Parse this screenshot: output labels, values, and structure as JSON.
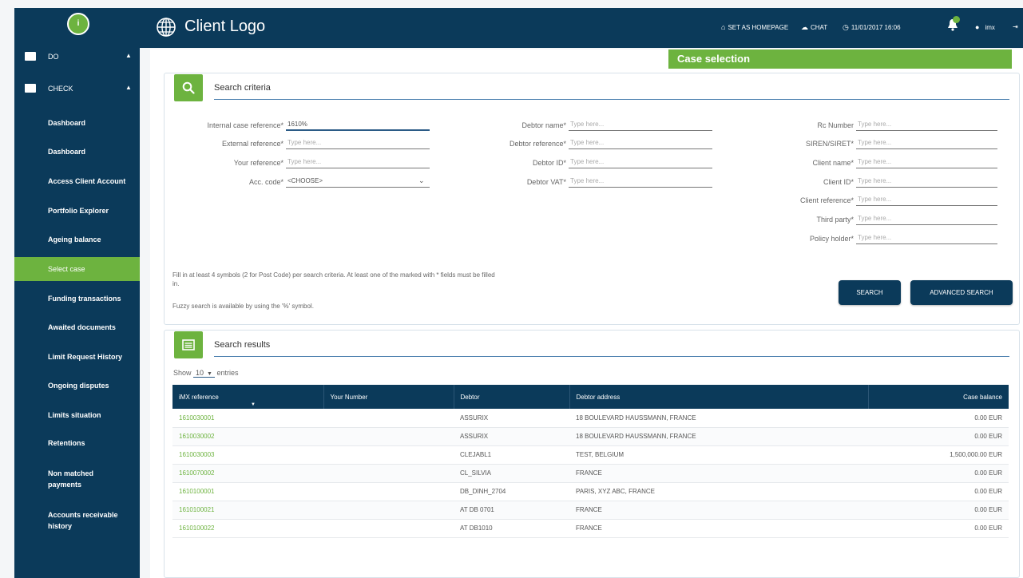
{
  "sidebar": {
    "logo_letter": "i",
    "groups": [
      {
        "label": "DO",
        "caret": "▲"
      },
      {
        "label": "CHECK",
        "caret": "▲"
      }
    ],
    "items": [
      {
        "label": "Dashboard"
      },
      {
        "label": "Dashboard"
      },
      {
        "label": "Access Client Account"
      },
      {
        "label": "Portfolio Explorer"
      },
      {
        "label": "Ageing balance"
      },
      {
        "label": "Select case"
      },
      {
        "label": "Funding transactions"
      },
      {
        "label": "Awaited documents"
      },
      {
        "label": "Limit Request History"
      },
      {
        "label": "Ongoing disputes"
      },
      {
        "label": "Limits situation"
      },
      {
        "label": "Retentions"
      },
      {
        "label": "Non matched",
        "label2": "payments"
      },
      {
        "label": "Accounts receivable",
        "label2": "history"
      }
    ]
  },
  "header": {
    "brand": "Client Logo",
    "set_homepage": "SET AS HOMEPAGE",
    "chat": "CHAT",
    "datetime": "11/01/2017 16:06",
    "user": "imx"
  },
  "case_tab": "Case selection",
  "search_criteria": {
    "title": "Search criteria",
    "fields": {
      "internal_case_reference": {
        "label": "Internal case reference*",
        "value": "1610%"
      },
      "external_reference": {
        "label": "External reference*",
        "placeholder": "Type here..."
      },
      "your_reference": {
        "label": "Your reference*",
        "placeholder": "Type here..."
      },
      "acc_code": {
        "label": "Acc. code*",
        "value": "<CHOOSE>"
      },
      "debtor_name": {
        "label": "Debtor name*",
        "placeholder": "Type here..."
      },
      "debtor_reference": {
        "label": "Debtor reference*",
        "placeholder": "Type here..."
      },
      "debtor_id": {
        "label": "Debtor ID*",
        "placeholder": "Type here..."
      },
      "debtor_vat": {
        "label": "Debtor VAT*",
        "placeholder": "Type here..."
      },
      "rc_number": {
        "label": "Rc Number",
        "placeholder": "Type here..."
      },
      "siren_siret": {
        "label": "SIREN/SIRET*",
        "placeholder": "Type here..."
      },
      "client_name": {
        "label": "Client name*",
        "placeholder": "Type here..."
      },
      "client_id": {
        "label": "Client ID*",
        "placeholder": "Type here..."
      },
      "client_reference": {
        "label": "Client reference*",
        "placeholder": "Type here..."
      },
      "third_party": {
        "label": "Third party*",
        "placeholder": "Type here..."
      },
      "policy_holder": {
        "label": "Policy holder*",
        "placeholder": "Type here..."
      }
    },
    "hint_line1": "Fill in at least 4 symbols (2 for Post Code) per search criteria. At least one of the marked with * fields must be filled",
    "hint_line2": "in.",
    "hint_fuzzy": "Fuzzy search is available by using the '%' symbol.",
    "search_button": "SEARCH",
    "advanced_button": "ADVANCED SEARCH"
  },
  "search_results": {
    "title": "Search results",
    "show_label": "Show",
    "entries_value": "10",
    "entries_label": "entries",
    "columns": [
      "iMX reference",
      "Your Number",
      "Debtor",
      "Debtor address",
      "Case balance"
    ],
    "rows": [
      {
        "ref": "1610030001",
        "your_number": "",
        "debtor": "ASSURIX",
        "address": "18 BOULEVARD HAUSSMANN, FRANCE",
        "balance": "0.00 EUR"
      },
      {
        "ref": "1610030002",
        "your_number": "",
        "debtor": "ASSURIX",
        "address": "18 BOULEVARD HAUSSMANN, FRANCE",
        "balance": "0.00 EUR"
      },
      {
        "ref": "1610030003",
        "your_number": "",
        "debtor": "CLEJABL1",
        "address": "TEST, BELGIUM",
        "balance": "1,500,000.00 EUR"
      },
      {
        "ref": "1610070002",
        "your_number": "",
        "debtor": "CL_SILVIA",
        "address": "FRANCE",
        "balance": "0.00 EUR"
      },
      {
        "ref": "1610100001",
        "your_number": "",
        "debtor": "DB_DINH_2704",
        "address": "PARIS, XYZ ABC, FRANCE",
        "balance": "0.00 EUR"
      },
      {
        "ref": "1610100021",
        "your_number": "",
        "debtor": "AT DB 0701",
        "address": "FRANCE",
        "balance": "0.00 EUR"
      },
      {
        "ref": "1610100022",
        "your_number": "",
        "debtor": "AT DB1010",
        "address": "FRANCE",
        "balance": "0.00 EUR"
      }
    ]
  }
}
